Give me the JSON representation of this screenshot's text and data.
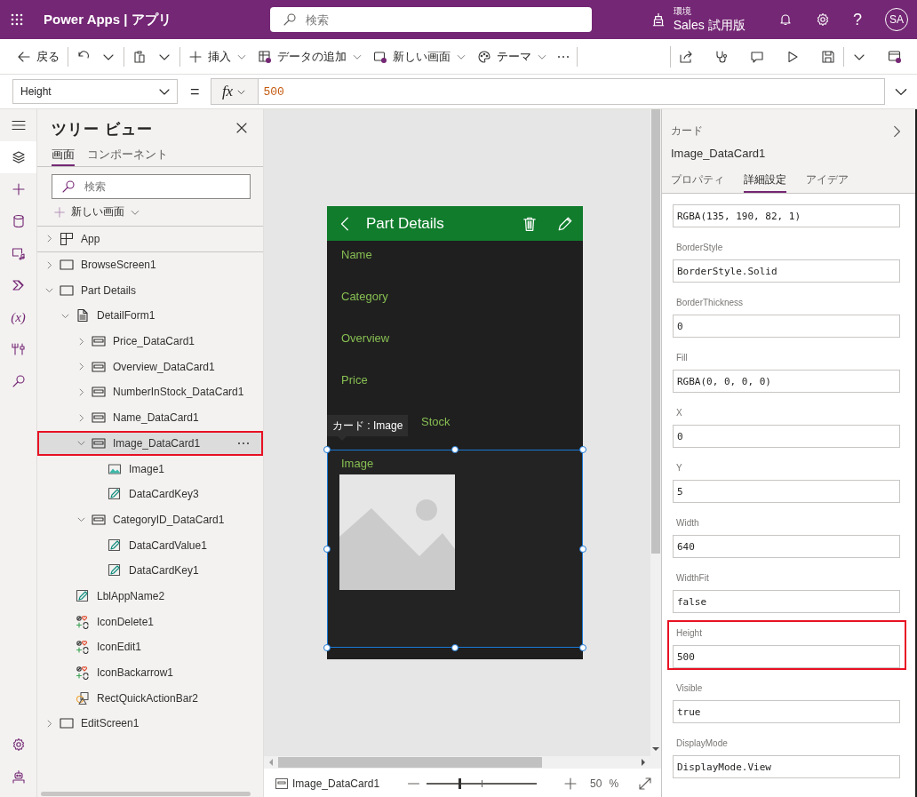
{
  "header": {
    "app_title": "Power Apps | アプリ",
    "search": {
      "placeholder": "検索"
    },
    "environment": {
      "caption": "環境",
      "name": "Sales 試用版"
    },
    "help": "?",
    "avatar": "SA"
  },
  "toolbar": {
    "groups": [
      [
        {
          "kind": "back",
          "label": "戻る",
          "menu": false
        }
      ],
      [
        {
          "kind": "undo",
          "menu": false
        },
        {
          "kind": "chevron",
          "menu": false
        }
      ],
      [
        {
          "kind": "paste",
          "menu": false
        },
        {
          "kind": "chevron",
          "menu": false
        }
      ],
      [
        {
          "kind": "plus",
          "label": "挿入",
          "menu": true
        },
        {
          "kind": "table",
          "label": "データの追加",
          "menu": true
        },
        {
          "kind": "screen",
          "label": "新しい画面",
          "menu": true
        },
        {
          "kind": "palette",
          "label": "テーマ",
          "menu": true
        },
        {
          "kind": "more",
          "menu": false
        }
      ]
    ],
    "right": [
      [
        {
          "kind": "share",
          "menu": false
        },
        {
          "kind": "stethoscope",
          "menu": false
        },
        {
          "kind": "comment",
          "menu": false
        },
        {
          "kind": "play",
          "menu": false
        },
        {
          "kind": "save",
          "menu": false
        }
      ],
      [
        {
          "kind": "chevron",
          "menu": false
        },
        {
          "kind": "publish",
          "menu": false
        }
      ]
    ]
  },
  "formula_bar": {
    "property": "Height",
    "equals": "=",
    "fx": "fx",
    "formula": "500"
  },
  "rail": [
    {
      "kind": "menu",
      "selected": false
    },
    {
      "kind": "layers",
      "selected": true
    },
    {
      "kind": "plus",
      "selected": false
    },
    {
      "kind": "database",
      "selected": false
    },
    {
      "kind": "media",
      "selected": false
    },
    {
      "kind": "automate",
      "selected": false
    },
    {
      "kind": "variables",
      "label": "(x)",
      "selected": false
    },
    {
      "kind": "tools",
      "selected": false
    },
    {
      "kind": "search",
      "selected": false
    }
  ],
  "rail_bottom": [
    {
      "kind": "settings",
      "selected": false
    },
    {
      "kind": "bot",
      "selected": false
    }
  ],
  "tree_view": {
    "title": "ツリー ビュー",
    "tabs": [
      {
        "label": "画面",
        "selected": true
      },
      {
        "label": "コンポーネント",
        "selected": false
      }
    ],
    "search": {
      "placeholder": "検索"
    },
    "new_screen": "新しい画面",
    "tree": [
      {
        "label": "App",
        "kind": "app",
        "expanded": false,
        "selected": false,
        "highlighted": false
      },
      {
        "label": "BrowseScreen1",
        "kind": "screen",
        "expanded": false,
        "selected": false,
        "highlighted": false
      },
      {
        "label": "Part Details",
        "kind": "screen",
        "expanded": true,
        "selected": false,
        "highlighted": false,
        "children": [
          {
            "label": "DetailForm1",
            "kind": "form",
            "expanded": true,
            "selected": false,
            "highlighted": false,
            "children": [
              {
                "label": "Price_DataCard1",
                "kind": "card",
                "expanded": false,
                "selected": false,
                "highlighted": false
              },
              {
                "label": "Overview_DataCard1",
                "kind": "card",
                "expanded": false,
                "selected": false,
                "highlighted": false
              },
              {
                "label": "NumberInStock_DataCard1",
                "kind": "card",
                "expanded": false,
                "selected": false,
                "highlighted": false
              },
              {
                "label": "Name_DataCard1",
                "kind": "card",
                "expanded": false,
                "selected": false,
                "highlighted": false
              },
              {
                "label": "Image_DataCard1",
                "kind": "card",
                "expanded": true,
                "selected": true,
                "highlighted": true,
                "children": [
                  {
                    "label": "Image1",
                    "kind": "image",
                    "selected": false,
                    "highlighted": false
                  },
                  {
                    "label": "DataCardKey3",
                    "kind": "label",
                    "selected": false,
                    "highlighted": false
                  }
                ]
              },
              {
                "label": "CategoryID_DataCard1",
                "kind": "card",
                "expanded": true,
                "selected": false,
                "highlighted": false,
                "children": [
                  {
                    "label": "DataCardValue1",
                    "kind": "label",
                    "selected": false,
                    "highlighted": false
                  },
                  {
                    "label": "DataCardKey1",
                    "kind": "label",
                    "selected": false,
                    "highlighted": false
                  }
                ]
              }
            ]
          },
          {
            "label": "LblAppName2",
            "kind": "label",
            "selected": false,
            "highlighted": false
          },
          {
            "label": "IconDelete1",
            "kind": "icon",
            "selected": false,
            "highlighted": false
          },
          {
            "label": "IconEdit1",
            "kind": "icon",
            "selected": false,
            "highlighted": false
          },
          {
            "label": "IconBackarrow1",
            "kind": "icon",
            "selected": false,
            "highlighted": false
          },
          {
            "label": "RectQuickActionBar2",
            "kind": "rect",
            "selected": false,
            "highlighted": false
          }
        ]
      },
      {
        "label": "EditScreen1",
        "kind": "screen",
        "expanded": false,
        "selected": false,
        "highlighted": false
      }
    ]
  },
  "phone": {
    "title": "Part Details",
    "tooltip": "カード : Image",
    "fields": [
      {
        "kind": "text",
        "label": "Name"
      },
      {
        "kind": "text",
        "label": "Category"
      },
      {
        "kind": "text",
        "label": "Overview"
      },
      {
        "kind": "text",
        "label": "Price"
      },
      {
        "kind": "text",
        "label": "Stock",
        "obscured": true
      },
      {
        "kind": "image",
        "label": "Image",
        "selected": true
      }
    ]
  },
  "status_bar": {
    "control": "Image_DataCard1",
    "zoom": {
      "level": 0.3
    },
    "zoom_value": "50",
    "zoom_unit": "%"
  },
  "properties_panel": {
    "type": "カード",
    "name": "Image_DataCard1",
    "tabs": [
      {
        "label": "プロパティ",
        "selected": false
      },
      {
        "label": "詳細設定",
        "selected": true
      },
      {
        "label": "アイデア",
        "selected": false
      }
    ],
    "properties": [
      {
        "value": "RGBA(135, 190, 82, 1)",
        "highlighted": false
      },
      {
        "label": "BorderStyle",
        "value": "BorderStyle.Solid",
        "highlighted": false
      },
      {
        "label": "BorderThickness",
        "value": "0",
        "highlighted": false
      },
      {
        "label": "Fill",
        "value": "RGBA(0, 0, 0, 0)",
        "highlighted": false
      },
      {
        "label": "X",
        "value": "0",
        "highlighted": false
      },
      {
        "label": "Y",
        "value": "5",
        "highlighted": false
      },
      {
        "label": "Width",
        "value": "640",
        "highlighted": false
      },
      {
        "label": "WidthFit",
        "value": "false",
        "highlighted": false
      },
      {
        "label": "Height",
        "value": "500",
        "highlighted": true
      },
      {
        "label": "Visible",
        "value": "true",
        "highlighted": false
      },
      {
        "label": "DisplayMode",
        "value": "DisplayMode.View",
        "highlighted": false
      }
    ]
  }
}
